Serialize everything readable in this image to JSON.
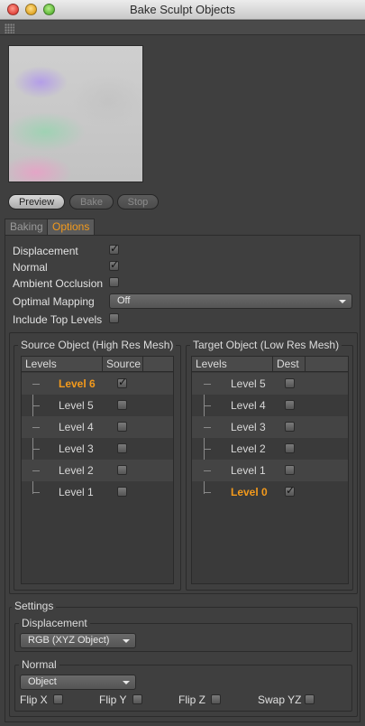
{
  "window": {
    "title": "Bake Sculpt Objects"
  },
  "buttons": {
    "preview": "Preview",
    "bake": "Bake",
    "stop": "Stop"
  },
  "tabs": [
    {
      "label": "Baking"
    },
    {
      "label": "Options"
    }
  ],
  "options": {
    "displacement": {
      "label": "Displacement",
      "checked": true
    },
    "normal": {
      "label": "Normal",
      "checked": true
    },
    "ambient_occlusion": {
      "label": "Ambient Occlusion",
      "checked": false
    },
    "optimal_mapping": {
      "label": "Optimal Mapping",
      "value": "Off"
    },
    "include_top_levels": {
      "label": "Include Top Levels",
      "checked": false
    }
  },
  "source": {
    "title": "Source Object (High Res Mesh)",
    "columns": [
      "Levels",
      "Source"
    ],
    "rows": [
      {
        "label": "Level 6",
        "checked": true,
        "current": true
      },
      {
        "label": "Level 5",
        "checked": false
      },
      {
        "label": "Level 4",
        "checked": false
      },
      {
        "label": "Level 3",
        "checked": false
      },
      {
        "label": "Level 2",
        "checked": false
      },
      {
        "label": "Level 1",
        "checked": false
      }
    ]
  },
  "target": {
    "title": "Target Object (Low Res Mesh)",
    "columns": [
      "Levels",
      "Dest"
    ],
    "rows": [
      {
        "label": "Level 5",
        "checked": false
      },
      {
        "label": "Level 4",
        "checked": false
      },
      {
        "label": "Level 3",
        "checked": false
      },
      {
        "label": "Level 2",
        "checked": false
      },
      {
        "label": "Level 1",
        "checked": false
      },
      {
        "label": "Level 0",
        "checked": true,
        "current": true
      }
    ]
  },
  "settings": {
    "title": "Settings",
    "displacement": {
      "label": "Displacement",
      "value": "RGB (XYZ Object)"
    },
    "normal": {
      "label": "Normal",
      "value": "Object",
      "flip_x": "Flip X",
      "flip_y": "Flip Y",
      "flip_z": "Flip Z",
      "swap_yz": "Swap YZ"
    }
  },
  "colors": {
    "accent": "#f39a1c",
    "panel": "#3f3f3f"
  }
}
